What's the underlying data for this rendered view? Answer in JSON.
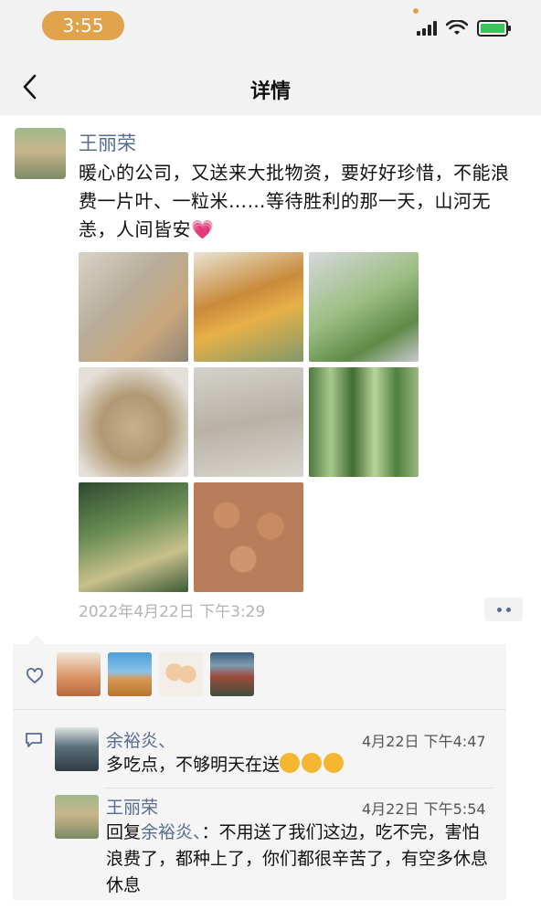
{
  "status_bar": {
    "time": "3:55"
  },
  "nav": {
    "title": "详情"
  },
  "post": {
    "author": "王丽荣",
    "text": "暖心的公司，又送来大批物资，要好好珍惜，不能浪费一片叶、一粒米……等待胜利的那一天，山河无恙，人间皆安",
    "emoji": "💗",
    "timestamp": "2022年4月22日 下午3:29"
  },
  "comments": [
    {
      "author": "余裕炎、",
      "time": "4月22日 下午4:47",
      "text": "多吃点，不够明天在送"
    },
    {
      "author": "王丽荣",
      "time": "4月22日 下午5:54",
      "reply_prefix": "回复",
      "reply_to": "余裕炎、",
      "text": "：不用送了我们这边，吃不完，害怕浪费了，都种上了，你们都很辛苦了，有空多休息休息"
    }
  ],
  "colors": {
    "link": "#576b95",
    "time_pill": "#e0a24a",
    "battery": "#35c759"
  }
}
